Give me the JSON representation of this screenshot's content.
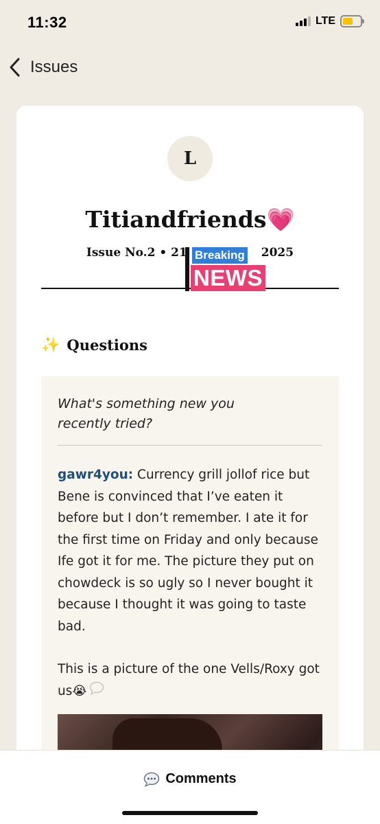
{
  "status": {
    "time": "11:32",
    "network": "LTE",
    "battery_color": "#f5c400",
    "battery_level": 0.6
  },
  "nav": {
    "back_label": "Issues"
  },
  "publication": {
    "avatar_letter": "L",
    "title": "Titiandfriends💗",
    "issue_left": "Issue No.2 • 21",
    "issue_right": "2025"
  },
  "sticker": {
    "breaking": "Breaking",
    "news": "NEWS",
    "breaking_color": "#2f7fd9",
    "news_color": "#ea3f72"
  },
  "section": {
    "icon": "✨",
    "title": "Questions"
  },
  "qa": {
    "question_line1": "What's something new you",
    "question_line2": "recently tried?",
    "author": "gawr4you:",
    "answer_p1": " Currency grill jollof rice but Bene is convinced that I’ve eaten it before but I don’t remember. I ate it for the first time on Friday and only because Ife got it for me. The picture they put on chowdeck is so ugly so I never bought it because I thought it was going to taste bad.",
    "answer_p2": "This is a picture of the one Vells/Roxy got us",
    "answer_p2_emoji": "😭"
  },
  "bottom": {
    "comments_label": "Comments"
  }
}
